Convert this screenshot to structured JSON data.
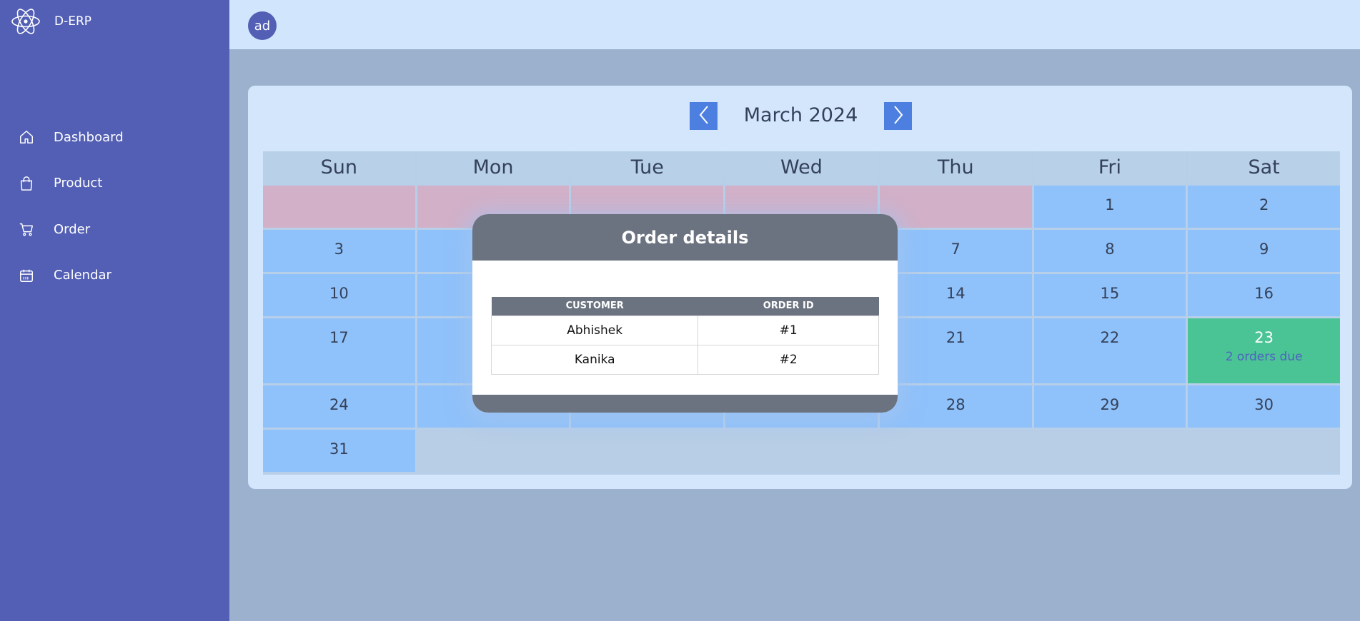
{
  "app": {
    "name": "D-ERP"
  },
  "sidebar": {
    "items": [
      {
        "label": "Dashboard",
        "icon": "home-icon"
      },
      {
        "label": "Product",
        "icon": "shopping-bag-icon"
      },
      {
        "label": "Order",
        "icon": "cart-icon"
      },
      {
        "label": "Calendar",
        "icon": "calendar-icon"
      }
    ]
  },
  "topbar": {
    "avatar_text": "ad"
  },
  "calendar": {
    "month_title": "March 2024",
    "weekdays": [
      "Sun",
      "Mon",
      "Tue",
      "Wed",
      "Thu",
      "Fri",
      "Sat"
    ],
    "due_day": "23",
    "due_label": "2 orders due"
  },
  "modal": {
    "title": "Order details",
    "headers": [
      "CUSTOMER",
      "ORDER ID"
    ],
    "rows": [
      {
        "customer": "Abhishek",
        "order_id": "#1"
      },
      {
        "customer": "Kanika",
        "order_id": "#2"
      }
    ]
  },
  "colors": {
    "sidebar": "#525fb4",
    "topbar": "#d1e6fd",
    "day_cell": "#8fc1fa",
    "empty_cell": "#d2b0c8",
    "due_cell": "#4bc495",
    "modal_bar": "#6b7280"
  }
}
